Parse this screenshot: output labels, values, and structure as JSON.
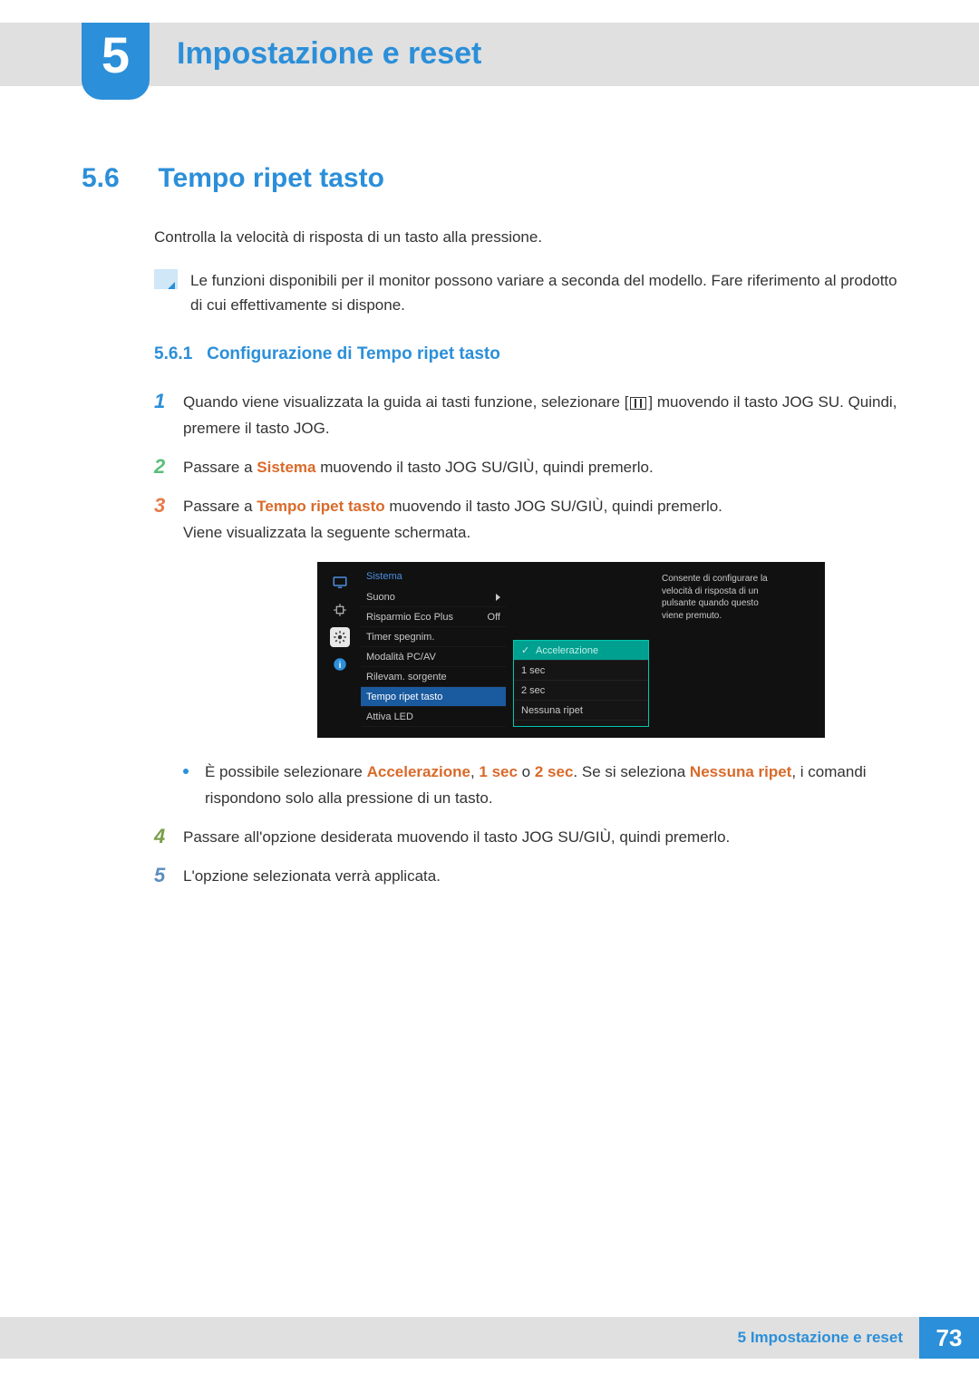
{
  "header": {
    "chapter_number": "5",
    "chapter_title": "Impostazione e reset"
  },
  "section": {
    "number": "5.6",
    "title": "Tempo ripet tasto",
    "intro": "Controlla la velocità di risposta di un tasto alla pressione.",
    "note": "Le funzioni disponibili per il monitor possono variare a seconda del modello. Fare riferimento al prodotto di cui effettivamente si dispone."
  },
  "subsection": {
    "number": "5.6.1",
    "title": "Configurazione di Tempo ripet tasto"
  },
  "steps": {
    "s1a": "Quando viene visualizzata la guida ai tasti funzione, selezionare [",
    "s1b": "] muovendo il tasto JOG SU. Quindi, premere il tasto JOG.",
    "s2a": "Passare a ",
    "s2_emph": "Sistema",
    "s2b": " muovendo il tasto JOG SU/GIÙ, quindi premerlo.",
    "s3a": "Passare a ",
    "s3_emph": "Tempo ripet tasto",
    "s3b": " muovendo il tasto JOG SU/GIÙ, quindi premerlo.",
    "s3c": "Viene visualizzata la seguente schermata.",
    "bullet_a": "È possibile selezionare ",
    "bullet_e1": "Accelerazione",
    "bullet_b": ", ",
    "bullet_e2": "1 sec",
    "bullet_c": " o ",
    "bullet_e3": "2 sec",
    "bullet_d": ". Se si seleziona ",
    "bullet_e4": "Nessuna ripet",
    "bullet_e": ", i comandi rispondono solo alla pressione di un tasto.",
    "s4": "Passare all'opzione desiderata muovendo il tasto JOG SU/GIÙ, quindi premerlo.",
    "s5": "L'opzione selezionata verrà applicata."
  },
  "osd": {
    "menu_title": "Sistema",
    "items": {
      "i0": "Suono",
      "i1": "Risparmio Eco Plus",
      "i1v": "Off",
      "i2": "Timer spegnim.",
      "i3": "Modalità PC/AV",
      "i4": "Rilevam. sorgente",
      "i5": "Tempo ripet tasto",
      "i6": "Attiva LED"
    },
    "sub": {
      "o0": "Accelerazione",
      "o1": "1 sec",
      "o2": "2 sec",
      "o3": "Nessuna ripet"
    },
    "desc": "Consente di configurare la velocità di risposta di un pulsante quando questo viene premuto."
  },
  "footer": {
    "label": "5 Impostazione e reset",
    "page": "73"
  }
}
